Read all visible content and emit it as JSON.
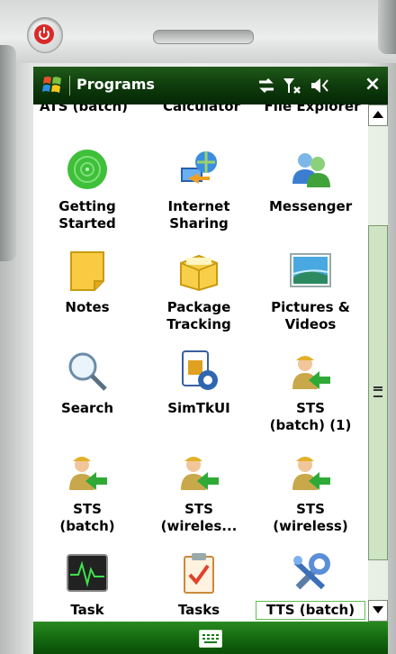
{
  "device": {
    "power_button": "power-icon"
  },
  "titlebar": {
    "title": "Programs",
    "icons": [
      "sync-icon",
      "signal-off-icon",
      "volume-icon"
    ],
    "close": "×"
  },
  "top_row_partial": [
    "ATS (batch)",
    "Calculator",
    "File Explorer"
  ],
  "grid": [
    {
      "label": "Getting Started",
      "icon": "getting-started-icon"
    },
    {
      "label": "Internet Sharing",
      "icon": "internet-sharing-icon"
    },
    {
      "label": "Messenger",
      "icon": "messenger-icon"
    },
    {
      "label": "Notes",
      "icon": "notes-icon"
    },
    {
      "label": "Package Tracking",
      "icon": "package-icon"
    },
    {
      "label": "Pictures & Videos",
      "icon": "pictures-icon"
    },
    {
      "label": "Search",
      "icon": "search-icon"
    },
    {
      "label": "SimTkUI",
      "icon": "simtk-icon"
    },
    {
      "label": "STS (batch) (1)",
      "icon": "sts-batch-icon"
    },
    {
      "label": "STS (batch)",
      "icon": "sts-batch-icon"
    },
    {
      "label": "STS (wireles...",
      "icon": "sts-wireless-icon"
    },
    {
      "label": "STS (wireless)",
      "icon": "sts-wireless-icon"
    },
    {
      "label": "Task",
      "icon": "task-manager-icon"
    },
    {
      "label": "Tasks",
      "icon": "tasks-icon"
    },
    {
      "label": "TTS (batch)",
      "icon": "tts-batch-icon",
      "selected": true
    }
  ],
  "bottombar": {
    "keyboard": "keyboard-icon"
  }
}
